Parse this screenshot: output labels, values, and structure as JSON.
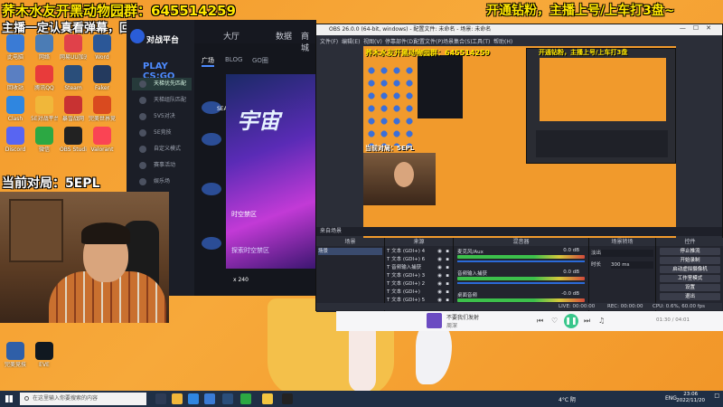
{
  "overlay": {
    "top_line1": "荞木水友开黑动物园群：645514259",
    "top_line2": "主播一定认真看弹幕，回复每一条互动信息!",
    "top_right": "开通钻粉，主播上号/上车打3盘~",
    "match_label": "当前对局：5EPL"
  },
  "desktop_icons": [
    {
      "name": "此电脑",
      "color": "#3a7bd5"
    },
    {
      "name": "网络",
      "color": "#4b7cb5"
    },
    {
      "name": "网易UU加速器",
      "color": "#e0414a"
    },
    {
      "name": "Word",
      "color": "#2b5797"
    },
    {
      "name": "回收站",
      "color": "#5a7fc2"
    },
    {
      "name": "腾讯QQ",
      "color": "#e83b3b"
    },
    {
      "name": "Steam",
      "color": "#2a4e7a"
    },
    {
      "name": "Faker",
      "color": "#243a5e"
    },
    {
      "name": "Clash",
      "color": "#2f86e0"
    },
    {
      "name": "5E对战平台",
      "color": "#f0b73a"
    },
    {
      "name": "暴雪战网",
      "color": "#c83232"
    },
    {
      "name": "完美世界竞技平台",
      "color": "#d94a1f"
    },
    {
      "name": "Discord",
      "color": "#5865f2"
    },
    {
      "name": "微信",
      "color": "#2ca843"
    },
    {
      "name": "OBS Studio",
      "color": "#222"
    },
    {
      "name": "Valorant",
      "color": "#fa4454"
    },
    {
      "name": "完美竞技",
      "color": "#2f5fa8"
    },
    {
      "name": "EVE",
      "color": "#101820"
    }
  ],
  "platform": {
    "logo": "对战平台",
    "game": "PLAY CS:GO",
    "top_tabs": [
      "大厅",
      "数据",
      "商城"
    ],
    "badge": "新版",
    "sub_tabs": [
      "广场",
      "BLOG",
      "GO圈"
    ],
    "menu": [
      "天梯优先匹配",
      "天梯组队匹配",
      "5V5对决",
      "5E竞技",
      "自定义模式",
      "赛事活动",
      "娱乐场"
    ],
    "server_label": "SEArena",
    "banner_title": "宇宙",
    "banner_caption1": "时空禁区",
    "banner_caption2": "探索时空禁区",
    "count": "x 240"
  },
  "obs": {
    "title": "OBS 26.0.0 (64-bit, windows) - 配置文件: 未命名 - 场景: 未命名",
    "menu": [
      "文件(F)",
      "编辑(E)",
      "视图(V)",
      "停靠部件(D)",
      "配置文件(P)",
      "场景集合(S)",
      "工具(T)",
      "帮助(H)"
    ],
    "preview_text1": "荞木水友开黑动物园群：645514259",
    "preview_text2": "当前对局：5EPL",
    "preview_right": "开通钻粉，主播上号/上车打3盘",
    "scene_bar": "来自场景",
    "docks": {
      "scenes_header": "场景",
      "scenes": [
        "场景"
      ],
      "sources_header": "来源",
      "sources": [
        "文本 (GDI+) 4",
        "文本 (GDI+) 6",
        "音频输入捕获",
        "文本 (GDI+) 3",
        "文本 (GDI+) 2",
        "文本 (GDI+)",
        "文本 (GDI+) 5"
      ],
      "mixer_header": "混音器",
      "mixer": [
        {
          "label": "麦克风/Aux",
          "db": "0.0 dB"
        },
        {
          "label": "音频输入捕获",
          "db": "0.0 dB"
        },
        {
          "label": "桌面音频",
          "db": "-0.0 dB"
        }
      ],
      "transitions_header": "场景转场",
      "transition_value": "淡出",
      "duration_label": "时长",
      "duration_value": "300 ms",
      "controls_header": "控件",
      "controls": [
        "停止推流",
        "开始录制",
        "启动虚拟摄像机",
        "工作室模式",
        "设置",
        "退出"
      ]
    },
    "status": {
      "live": "LIVE: 00:00:00",
      "rec": "REC: 00:00:00",
      "cpu": "CPU: 0.6%, 60.00 fps"
    }
  },
  "player": {
    "title": "不要我们发射",
    "artist": "周深",
    "time": "01:30 / 04:01"
  },
  "taskbar": {
    "search_placeholder": "在这里输入你要搜索的内容",
    "weather": "4°C 阴",
    "lang": "ENG",
    "time": "23:06",
    "date": "2022/11/20"
  }
}
